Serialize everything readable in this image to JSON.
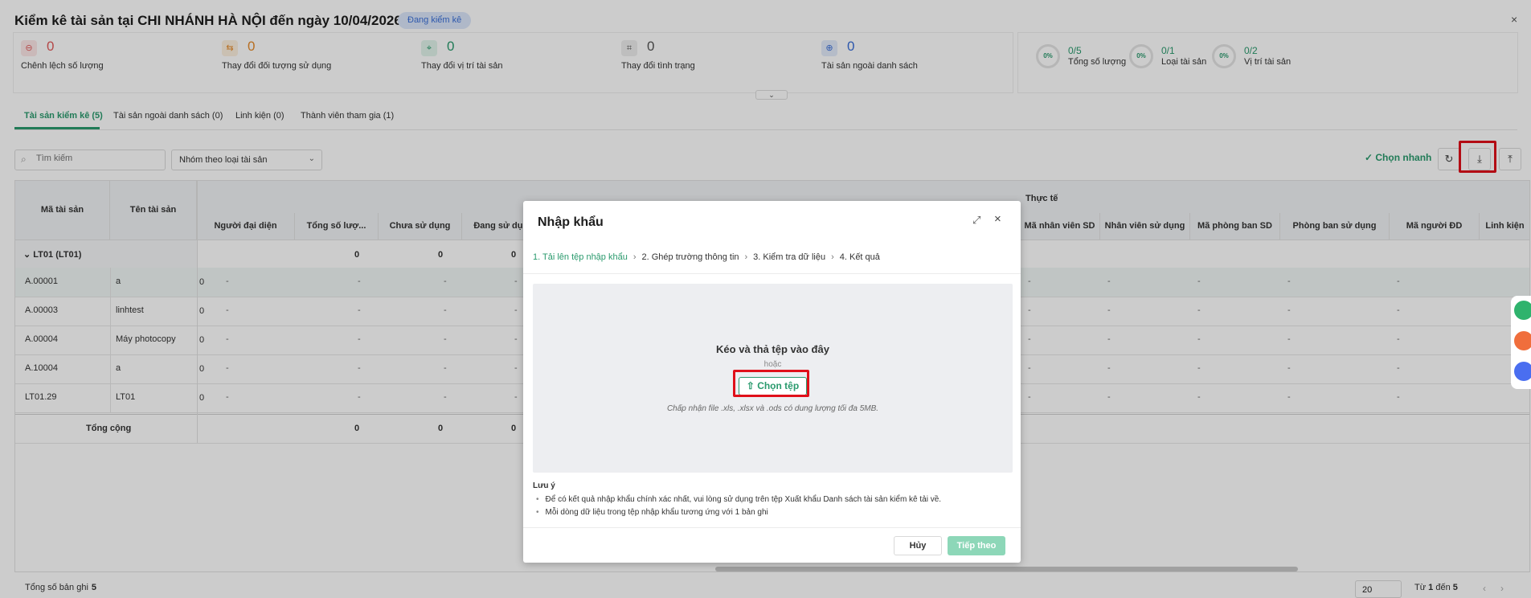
{
  "header": {
    "title": "Kiểm kê tài sản tại CHI NHÁNH HÀ NỘI đến ngày 10/04/2026",
    "status": "Đang kiểm kê",
    "close": "×"
  },
  "stats": [
    {
      "icon": "minus-circle-icon",
      "glyph": "⊖",
      "value": "0",
      "label": "Chênh lệch số lượng",
      "color": "#e15b5b",
      "bg": "#fde8e8"
    },
    {
      "icon": "swap-user-icon",
      "glyph": "⇆",
      "value": "0",
      "label": "Thay đổi đối tượng sử dụng",
      "color": "#e58a2a",
      "bg": "#fdf0df"
    },
    {
      "icon": "location-icon",
      "glyph": "⌖",
      "value": "0",
      "label": "Thay đổi vị trí tài sản",
      "color": "#2a9a6d",
      "bg": "#e2f4ec"
    },
    {
      "icon": "tag-icon",
      "glyph": "⌗",
      "value": "0",
      "label": "Thay đổi tình trạng",
      "color": "#555555",
      "bg": "#eeeeee"
    },
    {
      "icon": "plus-circle-icon",
      "glyph": "⊕",
      "value": "0",
      "label": "Tài sản ngoài danh sách",
      "color": "#3a6fd8",
      "bg": "#e3ebfb"
    }
  ],
  "progress": [
    {
      "pct": "0%",
      "value": "0/5",
      "label": "Tổng số lượng"
    },
    {
      "pct": "0%",
      "value": "0/1",
      "label": "Loại tài sản"
    },
    {
      "pct": "0%",
      "value": "0/2",
      "label": "Vị trí tài sản"
    }
  ],
  "tabs": [
    "Tài sản kiểm kê (5)",
    "Tài sản ngoài danh sách (0)",
    "Linh kiện (0)",
    "Thành viên tham gia (1)"
  ],
  "toolbar": {
    "search_placeholder": "Tìm kiếm",
    "group_by": "Nhóm theo loại tài sản",
    "quick_select": "Chọn nhanh"
  },
  "table": {
    "col_asset_code": "Mã tài sản",
    "col_asset_name": "Tên tài sản",
    "group_actual": "Thực tế",
    "cols_left": [
      "Người đại diện",
      "Tổng số lượ...",
      "Chưa sử dụng",
      "Đang sử dụ..."
    ],
    "cols_right": [
      "Mã nhân viên SD",
      "Nhân viên sử dụng",
      "Mã phòng ban SD",
      "Phòng ban sử dụng",
      "Mã người ĐD",
      "Linh kiện"
    ],
    "group_row": {
      "label": "LT01 (LT01)",
      "total": "0",
      "unused": "0",
      "using": "0"
    },
    "rows": [
      {
        "code": "A.00001",
        "name": "a"
      },
      {
        "code": "A.00003",
        "name": "linhtest"
      },
      {
        "code": "A.00004",
        "name": "Máy photocopy"
      },
      {
        "code": "A.10004",
        "name": "a"
      },
      {
        "code": "LT01.29",
        "name": "LT01"
      }
    ],
    "lead_value": "0",
    "dash": "-",
    "totals": {
      "label": "Tổng cộng",
      "total": "0",
      "unused": "0",
      "using": "0"
    }
  },
  "footer": {
    "total_label": "Tổng số bản ghi",
    "total_value": "5",
    "page_size": "20",
    "range_from_label": "Từ",
    "range_from": "1",
    "range_to_label": "đến",
    "range_to": "5"
  },
  "modal": {
    "title": "Nhập khẩu",
    "steps": [
      "1. Tải lên tệp nhập khẩu",
      "2. Ghép trường thông tin",
      "3. Kiểm tra dữ liệu",
      "4. Kết quả"
    ],
    "drop_title": "Kéo và thả tệp vào đây",
    "drop_or": "hoặc",
    "choose_file": "Chọn tệp",
    "hint": "Chấp nhận file .xls, .xlsx và .ods có dung lượng tối đa 5MB.",
    "note_title": "Lưu ý",
    "notes": [
      "Để có kết quả nhập khẩu chính xác nhất, vui lòng sử dụng trên tệp Xuất khẩu Danh sách tài sản kiểm kê tải về.",
      "Mỗi dòng dữ liệu trong tệp nhập khẩu tương ứng với 1 bản ghi"
    ],
    "cancel": "Hủy",
    "next": "Tiếp theo"
  },
  "colors": {
    "accent": "#2a9a6d",
    "highlight": "#e0101a"
  }
}
